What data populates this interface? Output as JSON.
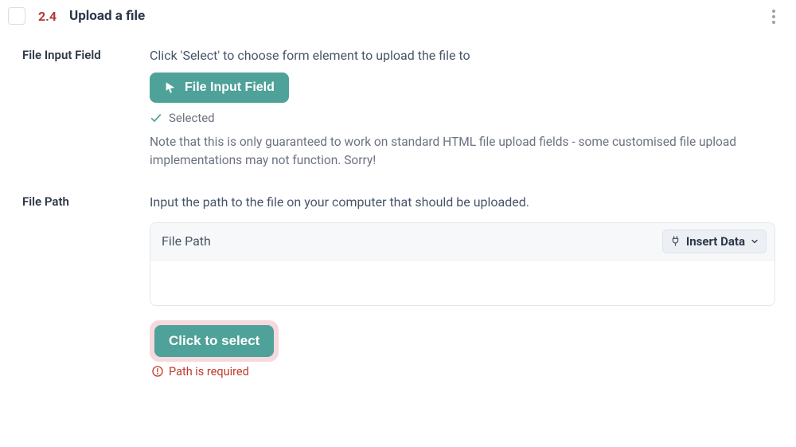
{
  "header": {
    "step_number": "2.4",
    "step_title": "Upload a file"
  },
  "fields": {
    "file_input": {
      "label": "File Input Field",
      "description": "Click 'Select' to choose form element to upload the file to",
      "button_label": "File Input Field",
      "status_text": "Selected",
      "note": "Note that this is only guaranteed to work on standard HTML file upload fields - some customised file upload implementations may not function. Sorry!"
    },
    "file_path": {
      "label": "File Path",
      "description": "Input the path to the file on your computer that should be uploaded.",
      "box_label": "File Path",
      "insert_data_label": "Insert Data",
      "select_button_label": "Click to select",
      "error_text": "Path is required"
    }
  }
}
